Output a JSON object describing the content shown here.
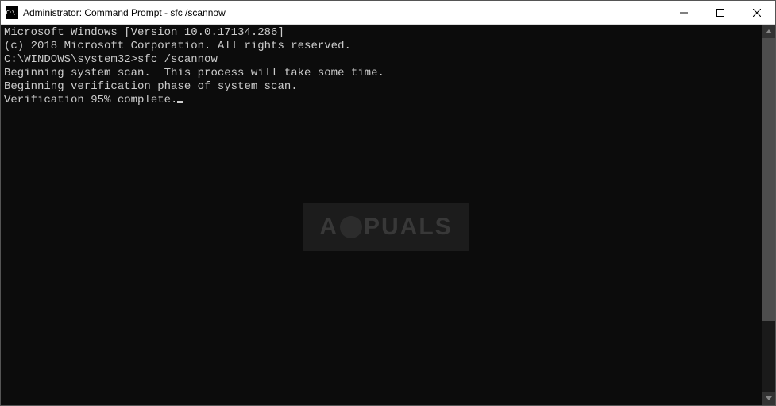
{
  "titlebar": {
    "icon_label": "C:\\.",
    "title": "Administrator: Command Prompt - sfc  /scannow"
  },
  "console": {
    "lines": [
      "Microsoft Windows [Version 10.0.17134.286]",
      "(c) 2018 Microsoft Corporation. All rights reserved.",
      "",
      "C:\\WINDOWS\\system32>sfc /scannow",
      "",
      "Beginning system scan.  This process will take some time.",
      "",
      "Beginning verification phase of system scan.",
      "Verification 95% complete."
    ]
  },
  "watermark": {
    "text_left": "A",
    "text_right": "PUALS"
  }
}
